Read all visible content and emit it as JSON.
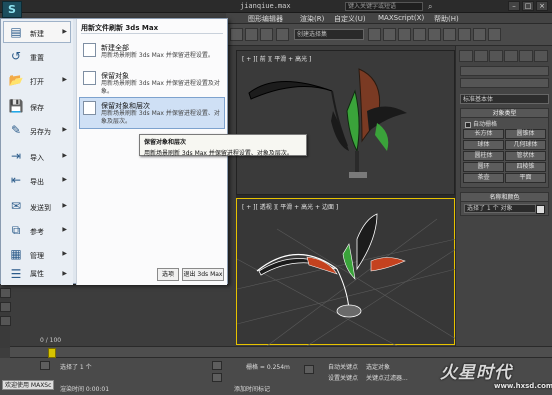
{
  "title": "jianqiue.max",
  "titlebar": {
    "search_placeholder": "键入关键字或短语"
  },
  "menubar": [
    "图形编辑器",
    "渲染(R)",
    "自定义(U)",
    "MAXScript(X)",
    "帮助(H)"
  ],
  "toolbar": {
    "selection_set": "创建选择集"
  },
  "app_menu": {
    "items": [
      {
        "label": "新建",
        "icon": "new-icon",
        "has_submenu": true,
        "active": true
      },
      {
        "label": "重置",
        "icon": "reset-icon",
        "has_submenu": false
      },
      {
        "label": "打开",
        "icon": "open-icon",
        "has_submenu": true
      },
      {
        "label": "保存",
        "icon": "save-icon",
        "has_submenu": false
      },
      {
        "label": "另存为",
        "icon": "save-as-icon",
        "has_submenu": true
      },
      {
        "label": "导入",
        "icon": "import-icon",
        "has_submenu": true
      },
      {
        "label": "导出",
        "icon": "export-icon",
        "has_submenu": true
      },
      {
        "label": "发送到",
        "icon": "send-to-icon",
        "has_submenu": true
      },
      {
        "label": "参考",
        "icon": "reference-icon",
        "has_submenu": true
      },
      {
        "label": "管理",
        "icon": "manage-icon",
        "has_submenu": true
      },
      {
        "label": "属性",
        "icon": "properties-icon",
        "has_submenu": true
      }
    ],
    "submenu_title": "用新文件刷新 3ds Max",
    "submenu_items": [
      {
        "title": "新建全部",
        "desc": "用新场景刷新 3ds Max 并保留进程设置。"
      },
      {
        "title": "保留对象",
        "desc": "用新场景刷新 3ds Max 并保留进程设置及对象。"
      },
      {
        "title": "保留对象和层次",
        "desc": "用新场景刷新 3ds Max 并保留进程设置、对象及层次。",
        "highlighted": true
      }
    ],
    "options_button": "选项",
    "exit_button": "退出 3ds Max"
  },
  "tooltip": {
    "title": "保留对象和层次",
    "text": "用新场景刷新 3ds Max 并保留进程设置、对象及层次。"
  },
  "viewports": {
    "top_label": "[ + ][ 前 ][ 平滑 + 高光 ]",
    "persp_label": "[ + ][ 透视 ][ 平滑 + 高光 + 边面 ]"
  },
  "command_panel": {
    "category": "标准基本体",
    "object_type_header": "对象类型",
    "autogrid": "自动栅格",
    "buttons": [
      "长方体",
      "圆锥体",
      "球体",
      "几何球体",
      "圆柱体",
      "管状体",
      "圆环",
      "四棱锥",
      "茶壶",
      "平面"
    ],
    "name_color_header": "名称和颜色",
    "name_value": "选择了 1 个 对象"
  },
  "timeline": {
    "frames": "0 / 100"
  },
  "status": {
    "selected": "选择了 1 个",
    "render_time": "渲染时间 0:00:01",
    "grid": "栅格 = 0.254m",
    "auto_key": "自动关键点",
    "selected_obj": "选定对象",
    "set_key": "设置关键点",
    "key_filters": "关键点过滤器...",
    "add_time_tag": "添加时间标记",
    "maxscript": "欢迎使用 MAXSc"
  },
  "watermark": {
    "brand": "火星时代",
    "url": "www.hxsd.com"
  },
  "colors": {
    "app_accent": "#1d4e5e",
    "highlight": "#cfe0f5",
    "viewport_active": "#e6c200"
  }
}
